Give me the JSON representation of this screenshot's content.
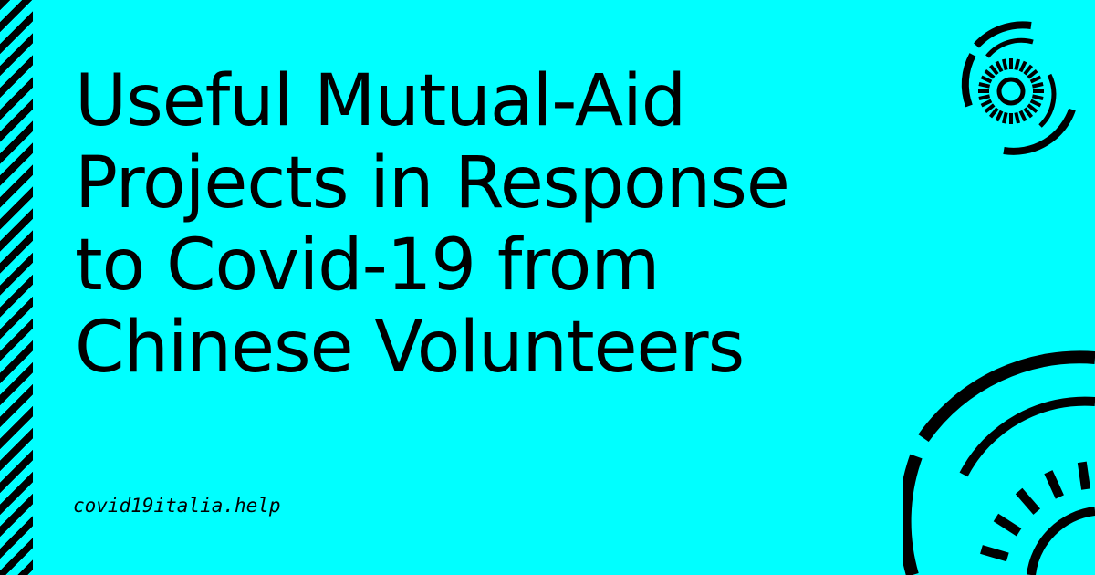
{
  "title_lines": [
    "Useful Mutual-Aid",
    "Projects in Response",
    "to Covid-19 from",
    "Chinese Volunteers"
  ],
  "site": "covid19italia.help",
  "colors": {
    "background": "#00ffff",
    "foreground": "#000000"
  },
  "decor": {
    "edge": "diagonal-stripes",
    "top_right": "radial-dial-icon",
    "bottom_right": "radial-dial-icon"
  }
}
